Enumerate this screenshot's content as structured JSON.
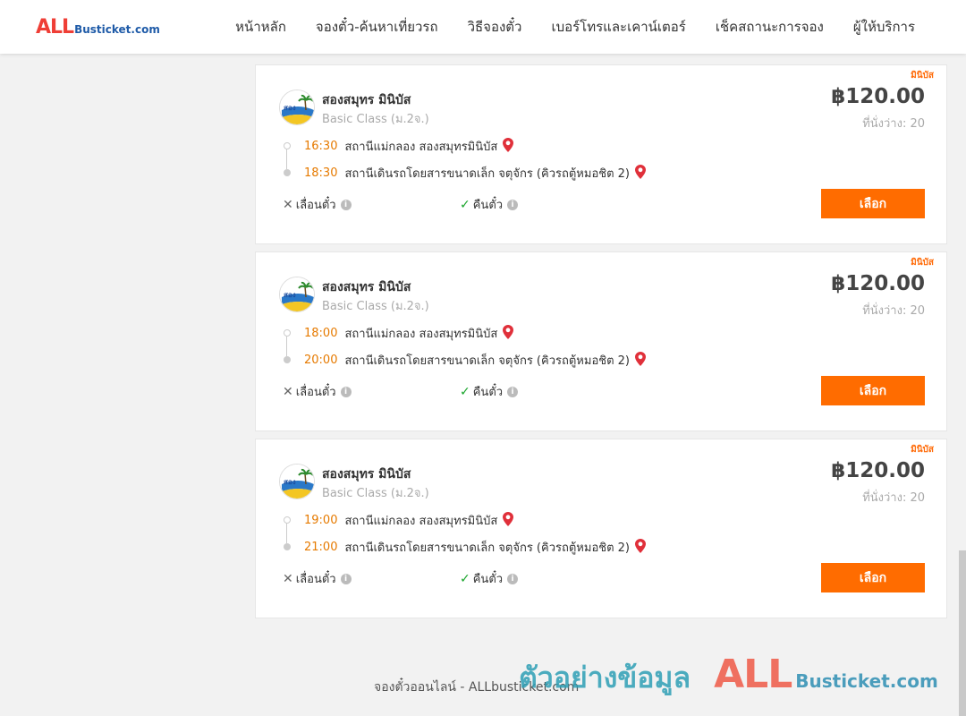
{
  "header": {
    "logo_all": "ALL",
    "logo_rest": "Busticket.com",
    "nav": [
      "หน้าหลัก",
      "จองตั๋ว-ค้นหาเที่ยวรถ",
      "วิธีจองตั๋ว",
      "เบอร์โทรและเคาน์เตอร์",
      "เช็คสถานะการจอง",
      "ผู้ให้บริการ"
    ]
  },
  "trips": [
    {
      "vehicle_type": "มินิบัส",
      "operator": "สองสมุทร มินิบัส",
      "bus_class": "Basic Class (ม.2จ.)",
      "depart_time": "16:30",
      "depart_place": "สถานีแม่กลอง สองสมุทรมินิบัส",
      "arrive_time": "18:30",
      "arrive_place": "สถานีเดินรถโดยสารขนาดเล็ก จตุจักร (คิวรถตู้หมอชิต 2)",
      "change_label": "เลื่อนตั๋ว",
      "refund_label": "คืนตั๋ว",
      "price": "฿120.00",
      "seats": "ที่นั่งว่าง: 20",
      "select_label": "เลือก"
    },
    {
      "vehicle_type": "มินิบัส",
      "operator": "สองสมุทร มินิบัส",
      "bus_class": "Basic Class (ม.2จ.)",
      "depart_time": "18:00",
      "depart_place": "สถานีแม่กลอง สองสมุทรมินิบัส",
      "arrive_time": "20:00",
      "arrive_place": "สถานีเดินรถโดยสารขนาดเล็ก จตุจักร (คิวรถตู้หมอชิต 2)",
      "change_label": "เลื่อนตั๋ว",
      "refund_label": "คืนตั๋ว",
      "price": "฿120.00",
      "seats": "ที่นั่งว่าง: 20",
      "select_label": "เลือก"
    },
    {
      "vehicle_type": "มินิบัส",
      "operator": "สองสมุทร มินิบัส",
      "bus_class": "Basic Class (ม.2จ.)",
      "depart_time": "19:00",
      "depart_place": "สถานีแม่กลอง สองสมุทรมินิบัส",
      "arrive_time": "21:00",
      "arrive_place": "สถานีเดินรถโดยสารขนาดเล็ก จตุจักร (คิวรถตู้หมอชิต 2)",
      "change_label": "เลื่อนตั๋ว",
      "refund_label": "คืนตั๋ว",
      "price": "฿120.00",
      "seats": "ที่นั่งว่าง: 20",
      "select_label": "เลือก"
    }
  ],
  "footer": {
    "text": "จองตั๋วออนไลน์ - ALLbusticket.com"
  },
  "watermark": {
    "thai": "ตัวอย่างข้อมูล",
    "all": "ALL",
    "rest": "Busticket.com"
  },
  "icons": {
    "pin": "map-pin-icon",
    "change": "x-icon",
    "refund": "check-icon",
    "info": "info-icon"
  },
  "colors": {
    "accent": "#ff6c00",
    "time": "#e67a00",
    "check": "#19a52b",
    "pin": "#e0303a"
  }
}
